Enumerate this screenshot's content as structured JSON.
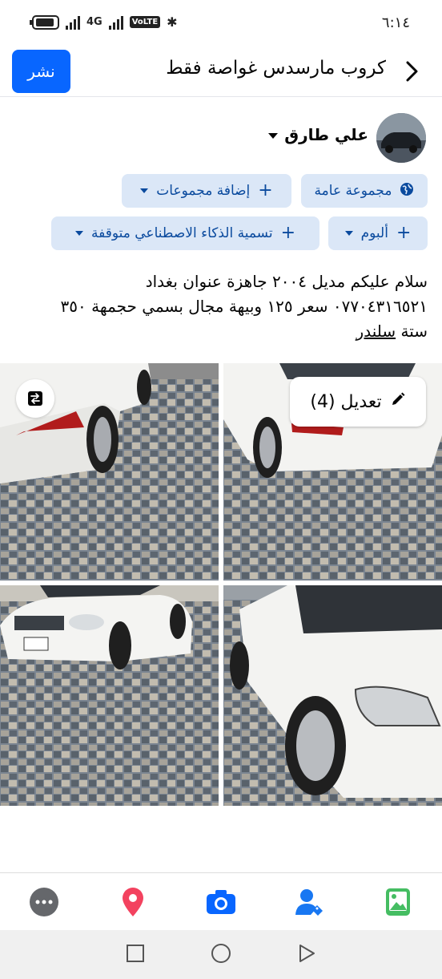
{
  "status_bar": {
    "time": "٦:١٤",
    "network": "4G",
    "volte": "VoLTE"
  },
  "header": {
    "title": "كروب مارسدس غواصة فقط",
    "publish_label": "نشر"
  },
  "author": {
    "name": "علي طارق"
  },
  "chips": {
    "audience": "مجموعة عامة",
    "add_groups": "إضافة مجموعات",
    "ai_label": "تسمية الذكاء الاصطناعي متوقفة",
    "album": "ألبوم"
  },
  "post": {
    "line1": "سلام عليكم مديل ٢٠٠٤ جاهزة عنوان بغداد",
    "line2": "٠٧٧٠٤٣١٦٥٢١ سعر ١٢٥ وبيهة مجال بسمي حجمهة ٣٥٠",
    "line3_a": "ستة ",
    "line3_b": "سلندر"
  },
  "photos": {
    "edit_label": "تعديل (4)"
  },
  "toolbar_icons": [
    "more-icon",
    "location-pin-icon",
    "camera-icon",
    "tag-people-icon",
    "photo-icon"
  ],
  "colors": {
    "accent": "#0866ff",
    "chip_bg": "#dbe7f7",
    "chip_text": "#0a4a9e"
  }
}
